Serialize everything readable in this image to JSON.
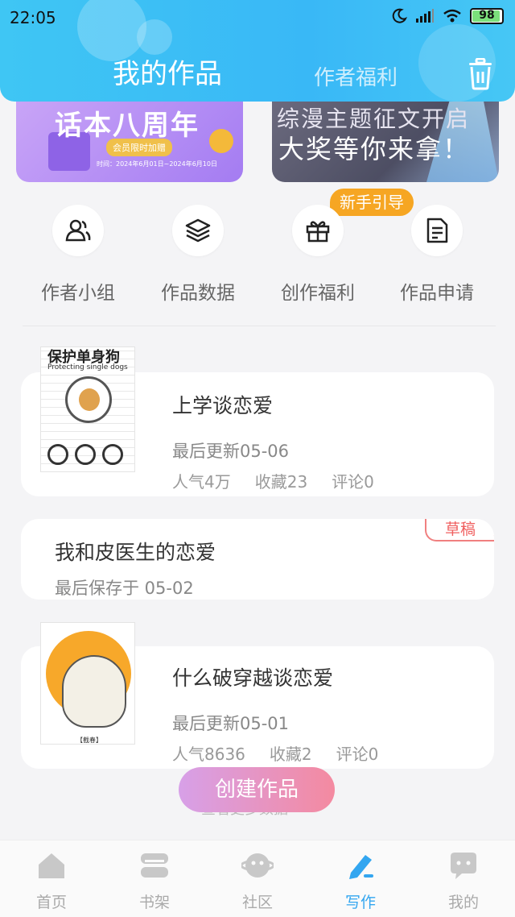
{
  "status_bar": {
    "time": "22:05",
    "battery": "98"
  },
  "header": {
    "tab_active": "我的作品",
    "tab_inactive": "作者福利",
    "trash_icon": "trash-icon"
  },
  "banners": {
    "left": {
      "title": "话本八周年",
      "pill": "会员限时加赠",
      "small": "时间：2024年6月01日~2024年6月10日"
    },
    "right": {
      "line1": "综漫主题征文开启",
      "line2": "大奖等你来拿！"
    }
  },
  "guide_badge": "新手引导",
  "quick_menu": [
    {
      "label": "作者小组",
      "icon": "group-icon"
    },
    {
      "label": "作品数据",
      "icon": "layers-icon"
    },
    {
      "label": "创作福利",
      "icon": "gift-icon"
    },
    {
      "label": "作品申请",
      "icon": "document-icon"
    }
  ],
  "works": [
    {
      "title": "上学谈恋爱",
      "updated": "最后更新05-06",
      "popularity": "人气4万",
      "favorites": "收藏23",
      "comments": "评论0",
      "cover_title": "保护单身狗",
      "cover_sub": "Protecting single dogs"
    },
    {
      "title": "我和皮医生的恋爱",
      "saved": "最后保存于 05-02",
      "tag": "草稿"
    },
    {
      "title": "什么破穿越谈恋爱",
      "updated": "最后更新05-01",
      "popularity": "人气8636",
      "favorites": "收藏2",
      "comments": "评论0",
      "cover_tag": "【截春】"
    }
  ],
  "create_button": "创建作品",
  "hint_text": "查看更多数据",
  "bottom_nav": [
    {
      "label": "首页",
      "icon": "home-icon"
    },
    {
      "label": "书架",
      "icon": "bookshelf-icon"
    },
    {
      "label": "社区",
      "icon": "community-icon"
    },
    {
      "label": "写作",
      "icon": "pen-icon"
    },
    {
      "label": "我的",
      "icon": "profile-icon"
    }
  ],
  "colors": {
    "accent": "#33a6f0",
    "draft": "#f06060",
    "guide": "#f6a623"
  }
}
